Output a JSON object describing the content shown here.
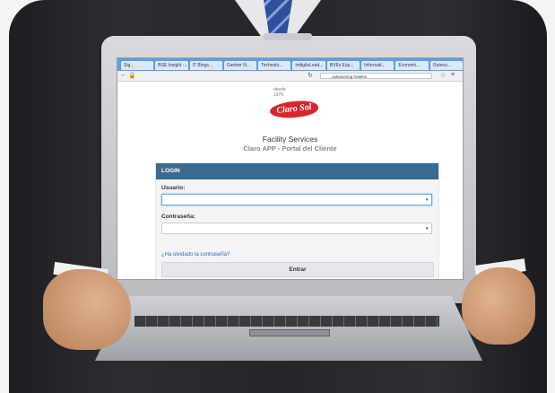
{
  "browser": {
    "tabs": [
      "Sig...",
      "BSE Insight -...",
      "IT Blogs...",
      "Gartner N...",
      "Technolo...",
      "indigital.ead...",
      "BVEs Exp...",
      "Informati...",
      "Economi...",
      "Outsou..."
    ],
    "address": "outsourcing hoteles"
  },
  "logo": {
    "desde": "desde",
    "year": "1970",
    "brand": "Claro Sol"
  },
  "page": {
    "subtitle": "Facility Services",
    "app_title": "Claro APP - Portal del Cliente"
  },
  "login": {
    "header": "LOGIN",
    "user_label": "Usuario:",
    "user_value": "",
    "password_label": "Contraseña:",
    "password_value": "",
    "forgot_link": "¿Ha olvidado la contraseña?",
    "submit_label": "Entrar"
  },
  "colors": {
    "brand_red": "#d6262c",
    "panel_header": "#3b6a90",
    "link": "#2a6ebc"
  }
}
